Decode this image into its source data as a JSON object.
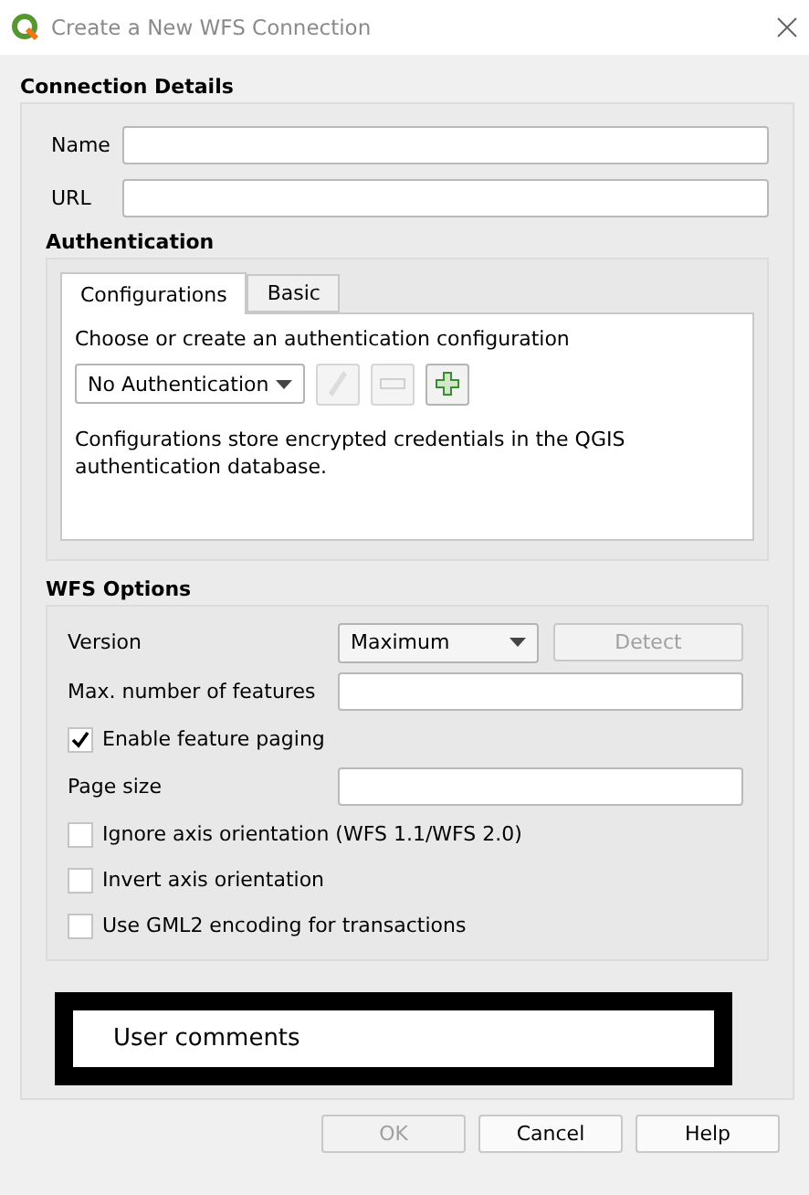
{
  "window": {
    "title": "Create a New WFS Connection"
  },
  "connection_details": {
    "title": "Connection Details",
    "fields": [
      {
        "label": "Name"
      },
      {
        "label": "URL"
      }
    ]
  },
  "authentication": {
    "title": "Authentication",
    "tabs": [
      {
        "label": "Configurations",
        "selected": true
      },
      {
        "label": "Basic",
        "selected": false
      }
    ],
    "prompt": "Choose or create an authentication configuration",
    "dropdown": {
      "value": "No Authentication"
    },
    "tools": [
      {
        "kind": "edit",
        "disabled": true
      },
      {
        "kind": "remove",
        "disabled": true
      },
      {
        "kind": "add",
        "disabled": false
      }
    ],
    "note": "Configurations store encrypted credentials in the QGIS authentication database."
  },
  "wfs_options": {
    "title": "WFS Options",
    "rows": [
      {
        "kind": "select",
        "label": "Version",
        "value": "Maximum",
        "button": {
          "label": "Detect",
          "disabled": true
        }
      },
      {
        "kind": "input",
        "label": "Max. number of features"
      },
      {
        "kind": "checkbox",
        "label": "Enable feature paging",
        "checked": true
      },
      {
        "kind": "input",
        "label": "Page size"
      },
      {
        "kind": "checkbox",
        "label": "Ignore axis orientation (WFS 1.1/WFS 2.0)",
        "checked": false
      },
      {
        "kind": "checkbox",
        "label": "Invert axis orientation",
        "checked": false
      },
      {
        "kind": "checkbox",
        "label": "Use GML2 encoding for transactions",
        "checked": false
      }
    ]
  },
  "user_comments": {
    "text": "User comments"
  },
  "buttons": [
    {
      "label": "OK",
      "disabled": true
    },
    {
      "label": "Cancel",
      "disabled": false
    },
    {
      "label": "Help",
      "disabled": false
    }
  ]
}
